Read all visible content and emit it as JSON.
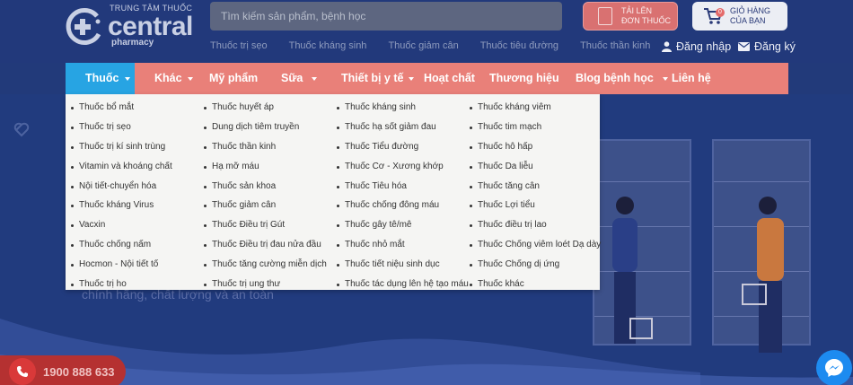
{
  "header": {
    "logo_small": "TRUNG TÂM THUỐC",
    "logo_big": "central",
    "logo_sub": "pharmacy",
    "search_placeholder": "Tìm kiếm sản phẩm, bệnh học",
    "quick_links": [
      "Thuốc trị sẹo",
      "Thuốc kháng sinh",
      "Thuốc giảm cân",
      "Thuốc tiêu đường",
      "Thuốc thần kinh"
    ],
    "upload_line1": "Tải lên",
    "upload_line2": "đơn thuốc",
    "cart_line1": "Giỏ hàng",
    "cart_line2": "của bạn",
    "cart_count": "0",
    "login": "Đăng nhập",
    "register": "Đăng ký"
  },
  "nav": {
    "items": [
      {
        "label": "Thuốc",
        "caret": true
      },
      {
        "label": "Khác",
        "caret": true
      },
      {
        "label": "Mỹ phẩm",
        "caret": false
      },
      {
        "label": "Sữa",
        "caret": true
      },
      {
        "label": "Thiết bị y tế",
        "caret": true
      },
      {
        "label": "Hoạt chất",
        "caret": false
      },
      {
        "label": "Thương hiệu",
        "caret": false
      },
      {
        "label": "Blog bệnh học",
        "caret": true
      },
      {
        "label": "Liên hệ",
        "caret": false
      }
    ]
  },
  "dropdown": {
    "col1": [
      "Thuốc bổ mắt",
      "Thuốc trị sẹo",
      "Thuốc trị kí sinh trùng",
      "Vitamin và khoáng chất",
      "Nội tiết-chuyển hóa",
      "Thuốc kháng Virus",
      "Vacxin",
      "Thuốc chống nấm",
      "Hocmon - Nội tiết tố",
      "Thuốc trị ho"
    ],
    "col2": [
      "Thuốc huyết áp",
      "Dung dịch tiêm truyền",
      "Thuốc thần kinh",
      "Hạ mỡ máu",
      "Thuốc sản khoa",
      "Thuốc giảm cân",
      "Thuốc Điều trị Gút",
      "Thuốc Điều trị đau nửa đầu",
      "Thuốc tăng cường miễn dịch",
      "Thuốc trị ung thư"
    ],
    "col3": [
      "Thuốc kháng sinh",
      "Thuốc hạ sốt giảm đau",
      "Thuốc Tiểu đường",
      "Thuốc Cơ - Xương khớp",
      "Thuốc Tiêu hóa",
      "Thuốc chống đông máu",
      "Thuốc gây tê/mê",
      "Thuốc nhỏ mắt",
      "Thuốc tiết niệu sinh dục",
      "Thuốc tác dụng lên hệ tạo máu"
    ],
    "col4": [
      "Thuốc kháng viêm",
      "Thuốc tim mạch",
      "Thuốc hô hấp",
      "Thuốc Da liễu",
      "Thuốc tăng cân",
      "Thuốc Lợi tiểu",
      "Thuốc điều trị lao",
      "Thuốc Chống viêm loét Dạ dày",
      "Thuốc Chống dị ứng",
      "Thuốc khác"
    ]
  },
  "banner": {
    "text": "chính hãng, chất lượng và an toàn"
  },
  "hotline": "1900 888 633",
  "colors": {
    "header_bg": "#22397b",
    "nav_bg": "#e98079",
    "nav_active": "#27a4e3",
    "dropdown_bg": "#f5f5f3"
  }
}
